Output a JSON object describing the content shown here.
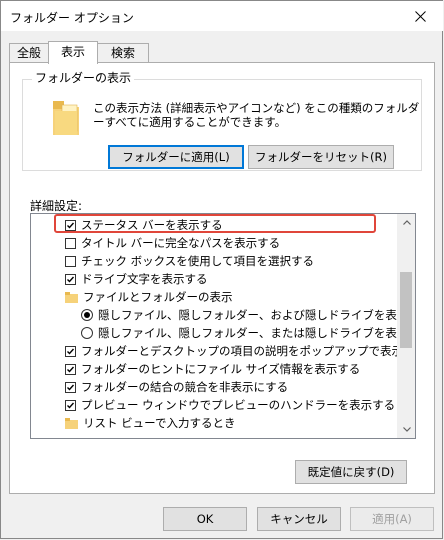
{
  "window": {
    "title": "フォルダー オプション"
  },
  "tabs": [
    {
      "label": "全般"
    },
    {
      "label": "表示"
    },
    {
      "label": "検索"
    }
  ],
  "folder_view": {
    "group_label": "フォルダーの表示",
    "description": "この表示方法 (詳細表示やアイコンなど) をこの種類のフォルダーすべてに適用することができます。",
    "apply_button": "フォルダーに適用(L)",
    "reset_button": "フォルダーをリセット(R)"
  },
  "advanced": {
    "label": "詳細設定:",
    "items": [
      {
        "type": "checkbox",
        "checked": true,
        "label": "ステータス バーを表示する"
      },
      {
        "type": "checkbox",
        "checked": false,
        "label": "タイトル バーに完全なパスを表示する"
      },
      {
        "type": "checkbox",
        "checked": false,
        "label": "チェック ボックスを使用して項目を選択する"
      },
      {
        "type": "checkbox",
        "checked": true,
        "label": "ドライブ文字を表示する"
      },
      {
        "type": "folder",
        "label": "ファイルとフォルダーの表示"
      },
      {
        "type": "radio",
        "checked": true,
        "label": "隠しファイル、隠しフォルダー、および隠しドライブを表示する"
      },
      {
        "type": "radio",
        "checked": false,
        "label": "隠しファイル、隠しフォルダー、または隠しドライブを表示しない"
      },
      {
        "type": "checkbox",
        "checked": true,
        "label": "フォルダーとデスクトップの項目の説明をポップアップで表示する"
      },
      {
        "type": "checkbox",
        "checked": true,
        "label": "フォルダーのヒントにファイル サイズ情報を表示する"
      },
      {
        "type": "checkbox",
        "checked": true,
        "label": "フォルダーの結合の競合を非表示にする"
      },
      {
        "type": "checkbox",
        "checked": true,
        "label": "プレビュー ウィンドウでプレビューのハンドラーを表示する"
      },
      {
        "type": "folder",
        "label": "リスト ビューで入力するとき"
      }
    ],
    "restore_button": "既定値に戻す(D)"
  },
  "footer": {
    "ok": "OK",
    "cancel": "キャンセル",
    "apply": "適用(A)"
  }
}
